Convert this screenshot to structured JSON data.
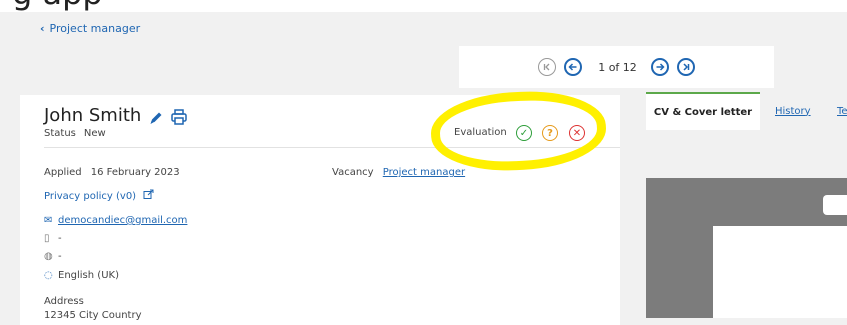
{
  "header": {
    "partial_title": "g app"
  },
  "breadcrumb": {
    "back_label": "Project manager"
  },
  "pagination": {
    "current": 1,
    "total": 12,
    "text": "1 of 12"
  },
  "candidate": {
    "name": "John Smith",
    "status_label": "Status",
    "status_value": "New",
    "evaluation_label": "Evaluation",
    "applied_label": "Applied",
    "applied_date": "16 February 2023",
    "vacancy_label": "Vacancy",
    "vacancy_value": "Project manager",
    "privacy_link": "Privacy policy (v0)",
    "email": "democandiec@gmail.com",
    "phone": "-",
    "website": "-",
    "language": "English (UK)",
    "address_label": "Address",
    "address_partial": "12345 City Country"
  },
  "tabs": [
    {
      "label": "CV & Cover letter",
      "active": true
    },
    {
      "label": "History",
      "active": false
    },
    {
      "label": "Te",
      "active": false
    }
  ],
  "colors": {
    "accent": "#1f66b2",
    "evaluation_positive": "#2e9e3a",
    "evaluation_maybe": "#e69a1b",
    "evaluation_negative": "#dd3333",
    "annotation": "#fff000",
    "active_tab_border": "#5ca84a"
  },
  "icons": {
    "evaluation_positive": "check-circle-icon",
    "evaluation_maybe": "question-circle-icon",
    "evaluation_negative": "x-circle-icon"
  }
}
